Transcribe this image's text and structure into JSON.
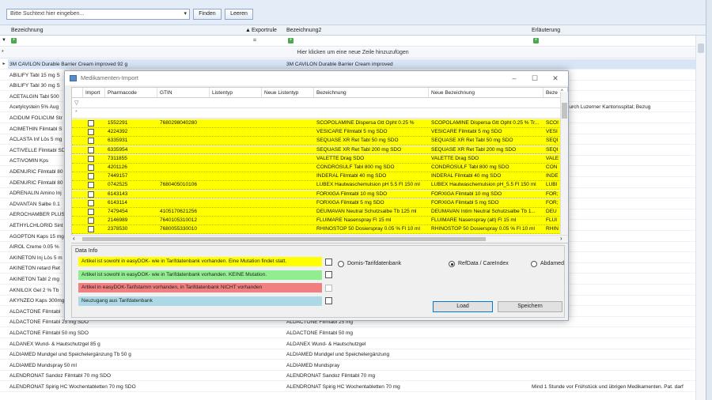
{
  "toolbar": {
    "search_placeholder": "Bitte Suchtext hier eingeben...",
    "find_label": "Finden",
    "clear_label": "Leeren"
  },
  "grid": {
    "headers": [
      "Bezeichnung",
      "Exportrule",
      "Bezeichnung2",
      "Erläuterung"
    ],
    "filter_ops": [
      "=",
      "="
    ],
    "new_row_hint": "Hier klicken um eine neue Zeile hinzuzufügen",
    "rows": [
      {
        "c1": "3M CAVILON Durable Barrier Cream improved 92 g",
        "c2": "3M CAVILON Durable Barrier Cream improved",
        "c3": ""
      },
      {
        "c1": "ABILIFY Tabl 15 mg S",
        "c2": "",
        "c3": ""
      },
      {
        "c1": "ABILIFY Tabl 30 mg S",
        "c2": "",
        "c3": ""
      },
      {
        "c1": "ACETALGIN Tabl 500",
        "c2": "",
        "c3": ""
      },
      {
        "c1": "Acetylcystein 5% Aug",
        "c2": "",
        "c3": "ur, Herstellung durch Luzerner Kantonsspital; Bezug"
      },
      {
        "c1": "ACIDUM FOLICUM Str",
        "c2": "",
        "c3": ""
      },
      {
        "c1": "ACIMETHIN Filmtabl S",
        "c2": "",
        "c3": ""
      },
      {
        "c1": "ACLASTA Inf Lös 5 mg",
        "c2": "",
        "c3": ""
      },
      {
        "c1": "ACTIVELLE Filmtabl SD",
        "c2": "",
        "c3": ""
      },
      {
        "c1": "ACTIVOMIN Kps",
        "c2": "",
        "c3": ""
      },
      {
        "c1": "ADENURIC Filmtabl 80",
        "c2": "",
        "c3": ""
      },
      {
        "c1": "ADENURIC Filmtabl 80",
        "c2": "",
        "c3": ""
      },
      {
        "c1": "ADRENALIN Amino Inj",
        "c2": "",
        "c3": ""
      },
      {
        "c1": "ADVANTAN Salbe 0.1",
        "c2": "",
        "c3": ""
      },
      {
        "c1": "AEROCHAMBER PLUS",
        "c2": "",
        "c3": ""
      },
      {
        "c1": "AETHYLCHLORID Sint",
        "c2": "",
        "c3": ""
      },
      {
        "c1": "AGOPTON Kaps 15 mg",
        "c2": "",
        "c3": ""
      },
      {
        "c1": "AIROL Creme 0.05 %",
        "c2": "",
        "c3": ""
      },
      {
        "c1": "AKINETON Inj Lös 5 m",
        "c2": "",
        "c3": ""
      },
      {
        "c1": "AKINETON retard Ret",
        "c2": "",
        "c3": ""
      },
      {
        "c1": "AKINETON Tabl 2 mg",
        "c2": "",
        "c3": ""
      },
      {
        "c1": "AKNILOX Gel 2 % Tb",
        "c2": "",
        "c3": ""
      },
      {
        "c1": "AKYNZEO Kaps 300mg",
        "c2": "",
        "c3": ""
      },
      {
        "c1": "ALDACTONE Filmtabl",
        "c2": "",
        "c3": ""
      },
      {
        "c1": "ALDACTONE Filmtabl 25 mg SDO",
        "c2": "ALDACTONE Filmtabl 25 mg",
        "c3": ""
      },
      {
        "c1": "ALDACTONE Filmtabl 50 mg SDO",
        "c2": "ALDACTONE Filmtabl 50 mg",
        "c3": ""
      },
      {
        "c1": "ALDANEX Wund- & Hautschutzgel 85 g",
        "c2": "ALDANEX Wund- & Hautschutzgel",
        "c3": ""
      },
      {
        "c1": "ALDIAMED Mundgel und Speichelergänzung Tb 50 g",
        "c2": "ALDIAMED Mundgel und Speichelergänzung",
        "c3": ""
      },
      {
        "c1": "ALDIAMED Mundspray 50 ml",
        "c2": "ALDIAMED Mundspray",
        "c3": ""
      },
      {
        "c1": "ALENDRONAT Sandoz Filmtabl 70 mg SDO",
        "c2": "ALENDRONAT Sandoz Filmtabl 70 mg",
        "c3": ""
      },
      {
        "c1": "ALENDRONAT Spirig HC Wochentabletten 70 mg SDO",
        "c2": "ALENDRONAT Spirig HC Wochentabletten 70 mg",
        "c3": "Mind 1 Stunde vor Frühstück und übrigen Medikamenten. Pat. darf"
      }
    ]
  },
  "dialog": {
    "title": "Medikamenten-Import",
    "columns": [
      "Import",
      "Pharmacode",
      "GTIN",
      "Listentyp",
      "Neue Listentyp",
      "Bezeichnung",
      "Neue Bezeichnung",
      "Beze"
    ],
    "rows": [
      {
        "pharmacode": "1552291",
        "gtin": "7680298040280",
        "bez": "SCOPOLAMINE Dispersa Gtt Opht 0.25 %",
        "neu": "SCOPOLAMINE Dispersa Gtt Opht 0.25 % Tr...",
        "b2": "SCOI"
      },
      {
        "pharmacode": "4224392",
        "gtin": "",
        "bez": "VESICARE Filmtabl 5 mg SDO",
        "neu": "VESICARE Filmtabl 5 mg SDO",
        "b2": "VESI"
      },
      {
        "pharmacode": "6335931",
        "gtin": "",
        "bez": "SEQUASE XR Ret Tabl 50 mg SDO",
        "neu": "SEQUASE XR Ret Tabl 50 mg SDO",
        "b2": "SEQI"
      },
      {
        "pharmacode": "6335954",
        "gtin": "",
        "bez": "SEQUASE XR Ret Tabl 200 mg SDO",
        "neu": "SEQUASE XR Ret Tabl 200 mg SDO",
        "b2": "SEQI"
      },
      {
        "pharmacode": "7311855",
        "gtin": "",
        "bez": "VALETTE Drag SDO",
        "neu": "VALETTE Drag SDO",
        "b2": "VALE"
      },
      {
        "pharmacode": "4201126",
        "gtin": "",
        "bez": "CONDROSULF Tabl 800 mg SDO",
        "neu": "CONDROSULF Tabl 800 mg SDO",
        "b2": "CON"
      },
      {
        "pharmacode": "7449157",
        "gtin": "",
        "bez": "INDERAL Filmtabl 40 mg SDO",
        "neu": "INDERAL Filmtabl 40 mg SDO",
        "b2": "INDE"
      },
      {
        "pharmacode": "0742525",
        "gtin": "7680405010106",
        "bez": "LUBEX Hautwaschemulsion pH 5.5 Fl 150 ml",
        "neu": "LUBEX Hautwaschemulsion pH_5.5 Fl 150 ml",
        "b2": "LUBI"
      },
      {
        "pharmacode": "6143143",
        "gtin": "",
        "bez": "FORXIGA Filmtabl 10 mg SDO",
        "neu": "FORXIGA Filmtabl 10 mg SDO",
        "b2": "FOR;"
      },
      {
        "pharmacode": "6143114",
        "gtin": "",
        "bez": "FORXIGA Filmtabl 5 mg SDO",
        "neu": "FORXIGA Filmtabl 5 mg SDO",
        "b2": "FOR;"
      },
      {
        "pharmacode": "7479454",
        "gtin": "4105170621256",
        "bez": "DEUMAVAN Neutral Schutzsalbe Tb 125 ml",
        "neu": "DEUMAVAN Intim Neutral Schutzsalbe Tb 1...",
        "b2": "DEU"
      },
      {
        "pharmacode": "2146989",
        "gtin": "7640105310012",
        "bez": "FLUIMARE Nasenspray Fl 15 ml",
        "neu": "FLUIMARE Nasenspray (alt) Fl 15 ml",
        "b2": "FLUI"
      },
      {
        "pharmacode": "2378530",
        "gtin": "7680055330010",
        "bez": "RHINOSTOP 50 Dosierspray 0.05 % Fl 10 ml",
        "neu": "RHINOSTOP 50 Dosierspray 0.05 % Fl 10 ml",
        "b2": "RHIN"
      }
    ],
    "data_info_label": "Data Info",
    "legend": [
      {
        "text": "Artikel ist sowohl in easyDOK- wie in Tarifdatenbank vorhanden. Eine Mutation findet statt.",
        "color": "#ffff00"
      },
      {
        "text": "Artikel ist sowohl in easyDOK- wie in Tarifdatenbank vorhanden. KEINE Mutation.",
        "color": "#90ee90"
      },
      {
        "text": "Artikel in easyDOK-Tarifstamm vorhanden, in Tarifdatenbank NICHT vorhanden",
        "color": "#f08080"
      },
      {
        "text": "Neuzugang aus Tarifdatenbank",
        "color": "#add8e6"
      }
    ],
    "radios": [
      "Domis-Tarifdatenbank",
      "RefData / CareIndex",
      "Abdamed"
    ],
    "load_label": "Load",
    "save_label": "Speichern"
  }
}
